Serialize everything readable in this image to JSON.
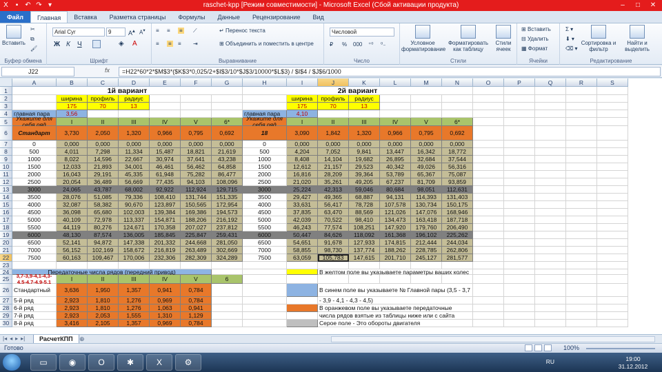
{
  "window": {
    "title": "raschet-kpp  [Режим совместимости]  -  Microsoft Excel (Сбой активации продукта)"
  },
  "ribbon_tabs": [
    "Файл",
    "Главная",
    "Вставка",
    "Разметка страницы",
    "Формулы",
    "Данные",
    "Рецензирование",
    "Вид"
  ],
  "ribbon": {
    "clipboard": {
      "paste": "Вставить",
      "label": "Буфер обмена"
    },
    "font": {
      "name": "Arial Cyr",
      "size": "9",
      "bold": "Ж",
      "italic": "К",
      "underline": "Ч",
      "label": "Шрифт"
    },
    "alignment": {
      "wrap": "Перенос текста",
      "merge": "Объединить и поместить в центре",
      "label": "Выравнивание"
    },
    "number": {
      "format": "Числовой",
      "percent": "%",
      "thousands": "000",
      "label": "Число"
    },
    "styles": {
      "conditional": "Условное форматирование",
      "as_table": "Форматировать как таблицу",
      "cell_styles": "Стили ячеек",
      "label": "Стили"
    },
    "cells": {
      "insert": "Вставить",
      "delete": "Удалить",
      "format": "Формат",
      "label": "Ячейки"
    },
    "editing": {
      "sort": "Сортировка и фильтр",
      "find": "Найти и выделить",
      "label": "Редактирование"
    }
  },
  "formula_bar": {
    "name_box": "J22",
    "fx": "fx",
    "formula": "=H22*60*2*$M$3*($K$3*0,025/2+$I$3/10*$J$3/10000*$L$3) / $I$4 / $J$6/1000"
  },
  "columns": [
    "A",
    "B",
    "C",
    "D",
    "E",
    "F",
    "G",
    "H",
    "I",
    "J",
    "K",
    "L",
    "M",
    "N",
    "O",
    "P",
    "Q",
    "R",
    "S"
  ],
  "rows": [
    "1",
    "2",
    "3",
    "4",
    "5",
    "6",
    "7",
    "8",
    "9",
    "10",
    "11",
    "12",
    "13",
    "14",
    "15",
    "16",
    "17",
    "18",
    "19",
    "20",
    "21",
    "22",
    "23",
    "24",
    "25",
    "26",
    "27",
    "28",
    "29",
    "30"
  ],
  "sheet": {
    "v1_title": "1й вариант",
    "v2_title": "2й вариант",
    "hdr_width": "ширина",
    "hdr_profile": "профиль",
    "hdr_radius": "радиус",
    "v1_width": "175",
    "v1_profile": "70",
    "v1_radius": "13",
    "v2_width": "175",
    "v2_profile": "70",
    "v2_radius": "13",
    "main_pair_label": "главная пара",
    "v1_main_pair": "3,56",
    "v2_main_pair": "4,10",
    "specify_row": "Укажите для себя ряд",
    "gears": [
      "I",
      "II",
      "III",
      "IV",
      "V",
      "6*"
    ],
    "v1_row_name": "Стандарт",
    "v2_row_name": "18",
    "v1_ratios": [
      "3,730",
      "2,050",
      "1,320",
      "0,966",
      "0,795",
      "0,692"
    ],
    "v2_ratios": [
      "3,090",
      "1,842",
      "1,320",
      "0,966",
      "0,795",
      "0,692"
    ],
    "rpm": [
      "0",
      "500",
      "1000",
      "1500",
      "2000",
      "2500",
      "3000",
      "3500",
      "4000",
      "4500",
      "5000",
      "5500",
      "6000",
      "6500",
      "7000",
      "7500"
    ],
    "v1_speeds": [
      [
        "0,000",
        "0,000",
        "0,000",
        "0,000",
        "0,000",
        "0,000"
      ],
      [
        "4,011",
        "7,298",
        "11,334",
        "15,487",
        "18,821",
        "21,619"
      ],
      [
        "8,022",
        "14,596",
        "22,667",
        "30,974",
        "37,641",
        "43,238"
      ],
      [
        "12,033",
        "21,893",
        "34,001",
        "46,461",
        "56,462",
        "64,858"
      ],
      [
        "16,043",
        "29,191",
        "45,335",
        "61,948",
        "75,282",
        "86,477"
      ],
      [
        "20,054",
        "36,489",
        "56,669",
        "77,435",
        "94,103",
        "108,096"
      ],
      [
        "24,065",
        "43,787",
        "68,002",
        "92,922",
        "112,924",
        "129,715"
      ],
      [
        "28,076",
        "51,085",
        "79,336",
        "108,410",
        "131,744",
        "151,335"
      ],
      [
        "32,087",
        "58,382",
        "90,670",
        "123,897",
        "150,565",
        "172,954"
      ],
      [
        "36,098",
        "65,680",
        "102,003",
        "139,384",
        "169,386",
        "194,573"
      ],
      [
        "40,109",
        "72,978",
        "113,337",
        "154,871",
        "188,206",
        "216,192"
      ],
      [
        "44,119",
        "80,276",
        "124,671",
        "170,358",
        "207,027",
        "237,812"
      ],
      [
        "48,130",
        "87,574",
        "136,005",
        "185,845",
        "225,847",
        "259,431"
      ],
      [
        "52,141",
        "94,872",
        "147,338",
        "201,332",
        "244,668",
        "281,050"
      ],
      [
        "56,152",
        "102,169",
        "158,672",
        "216,819",
        "263,489",
        "302,669"
      ],
      [
        "60,163",
        "109,467",
        "170,006",
        "232,306",
        "282,309",
        "324,289"
      ]
    ],
    "v2_speeds": [
      [
        "0,000",
        "0,000",
        "0,000",
        "0,000",
        "0,000",
        "0,000"
      ],
      [
        "4,204",
        "7,052",
        "9,841",
        "13,447",
        "16,342",
        "18,772"
      ],
      [
        "8,408",
        "14,104",
        "19,682",
        "26,895",
        "32,684",
        "37,544"
      ],
      [
        "12,612",
        "21,157",
        "29,523",
        "40,342",
        "49,026",
        "56,316"
      ],
      [
        "16,816",
        "28,209",
        "39,364",
        "53,789",
        "65,367",
        "75,087"
      ],
      [
        "21,020",
        "35,261",
        "49,205",
        "67,237",
        "81,709",
        "93,859"
      ],
      [
        "25,224",
        "42,313",
        "59,046",
        "80,684",
        "98,051",
        "112,631"
      ],
      [
        "29,427",
        "49,365",
        "68,887",
        "94,131",
        "114,393",
        "131,403"
      ],
      [
        "33,631",
        "56,417",
        "78,728",
        "107,578",
        "130,734",
        "150,175"
      ],
      [
        "37,835",
        "63,470",
        "88,569",
        "121,026",
        "147,076",
        "168,946"
      ],
      [
        "42,039",
        "70,522",
        "98,410",
        "134,473",
        "163,418",
        "187,718"
      ],
      [
        "46,243",
        "77,574",
        "108,251",
        "147,920",
        "179,760",
        "206,490"
      ],
      [
        "50,447",
        "84,626",
        "118,092",
        "161,368",
        "196,102",
        "225,262"
      ],
      [
        "54,651",
        "91,678",
        "127,933",
        "174,815",
        "212,444",
        "244,034"
      ],
      [
        "58,855",
        "98,730",
        "137,774",
        "188,262",
        "228,785",
        "262,806"
      ],
      [
        "63,059",
        "105,783",
        "147,615",
        "201,710",
        "245,127",
        "281,577"
      ]
    ],
    "ratio_table_title": "Передаточные числа рядов (передний привод)",
    "ratio_table_rows_hint": "3,7-3,9-4,1-4,3-4,5-4,7-4,9-5,1",
    "ratio_table_gears": [
      "I",
      "II",
      "III",
      "IV",
      "V",
      "6"
    ],
    "ratio_table": [
      {
        "name": "Стандартный",
        "values": [
          "3,636",
          "1,950",
          "1,357",
          "0,941",
          "0,784",
          ""
        ]
      },
      {
        "name": "5-й ряд",
        "values": [
          "2,923",
          "1,810",
          "1,276",
          "0,969",
          "0,784",
          ""
        ]
      },
      {
        "name": "6-й ряд",
        "values": [
          "2,923",
          "1,810",
          "1,276",
          "1,063",
          "0,941",
          ""
        ]
      },
      {
        "name": "7-й ряд",
        "values": [
          "2,923",
          "2,053",
          "1,555",
          "1,310",
          "1,129",
          ""
        ]
      },
      {
        "name": "8-й ряд",
        "values": [
          "3,416",
          "2,105",
          "1,357",
          "0,969",
          "0,784",
          ""
        ]
      }
    ],
    "legend_yellow": "В желтом поле вы указываете параметры ваших колес",
    "legend_blue_1": "В синем поле вы указываете № Главной пары (3,5 - 3,7",
    "legend_blue_2": "- 3,9 - 4,1 - 4,3 - 4,5)",
    "legend_orange_1": "В оранжевом поле вы указываете передаточные",
    "legend_orange_2": "числа рядов взятые из таблицы ниже или с сайта",
    "legend_gray": "Серое поле - Это обороты двигателя"
  },
  "sheet_tab": "РасчетКПП",
  "status": {
    "ready": "Готово",
    "zoom": "100%"
  },
  "taskbar": {
    "lang": "RU",
    "time": "19:00",
    "date": "31.12.2012"
  },
  "colors": {
    "yellow": "#ffff00",
    "orange": "#e8782a",
    "blue": "#8db3e2",
    "olive": "#c4bd97",
    "gray_dark": "#808080",
    "green_hdr": "#a9c46b",
    "ratio_hdr": "#8eb4e3",
    "title_red": "#e41c1c"
  }
}
